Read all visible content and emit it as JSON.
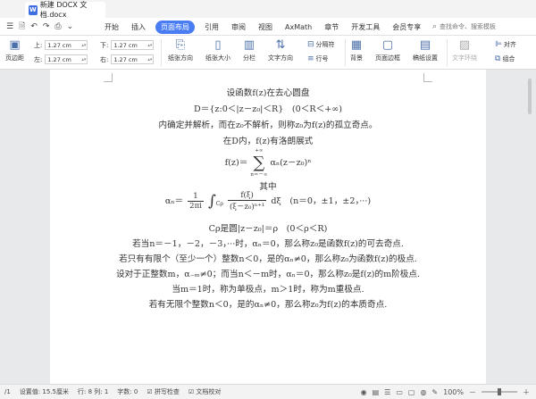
{
  "titlebar": {
    "app_icon": "W",
    "doc_title": "新建 DOCX 文档.docx"
  },
  "menubar": {
    "items": [
      "开始",
      "插入",
      "页面布局",
      "引用",
      "审阅",
      "视图",
      "AxMath",
      "章节",
      "开发工具",
      "会员专享"
    ],
    "active": "页面布局",
    "search_label": "查找命令、搜索模板"
  },
  "ribbon": {
    "margins_label": "页边距",
    "top_label": "上:",
    "top_value": "1.27 cm",
    "bottom_label": "下:",
    "bottom_value": "1.27 cm",
    "left_label": "左:",
    "left_value": "1.27 cm",
    "right_label": "右:",
    "right_value": "1.27 cm",
    "orientation": "纸张方向",
    "size": "纸张大小",
    "columns": "分栏",
    "text_direction": "文字方向",
    "separator": "分隔符",
    "line_number": "行号",
    "background": "背景",
    "page_border": "页面边框",
    "draft_settings": "稿纸设置",
    "text_wrap": "文字环绕",
    "align": "对齐",
    "group": "组合"
  },
  "document": {
    "lines": [
      "设函数f(z)在去心圆盘",
      "D＝{z:0＜|z－z₀|＜R}　(0＜R＜+∞)",
      "内确定并解析，而在z₀不解析，则称z₀为f(z)的孤立奇点。",
      "在D内，f(z)有洛朗展式",
      "其中",
      "Cρ是圆|z－z₀|＝ρ　(0＜ρ＜R)",
      "若当n＝－1，－2，－3，···时，αₙ＝0，那么称z₀是函数f(z)的可去奇点.",
      "若只有有限个（至少一个）整数n＜0，是的αₙ≠0，那么称z₀为函数f(z)的极点.",
      "设对于正整数m，α₋ₘ≠0；而当n＜－m时，αₙ＝0，那么称z₀是f(z)的m阶极点.",
      "当m＝1时，称为单极点，m＞1时，称为m重极点.",
      "若有无限个整数n＜0，是的αₙ≠0，那么称z₀为f(z)的本质奇点."
    ],
    "laurent": {
      "lhs": "f(z)＝",
      "upper": "+∞",
      "lower": "n＝－∞",
      "term": "αₙ(z－z₀)ⁿ"
    },
    "coef": {
      "lhs": "αₙ＝",
      "frac1_num": "1",
      "frac1_den": "2πi",
      "contour": "Cρ",
      "frac2_num": "f(ξ)",
      "frac2_den": "(ξ－z₀)ⁿ⁺¹",
      "tail": "dξ　(n＝0，±1，±2，···)"
    }
  },
  "statusbar": {
    "page": "/1",
    "setting_value": "设置值: 15.5厘米",
    "row_col": "行: 8  列: 1",
    "word_count": "字数: 0",
    "spell_check": "拼写检查",
    "doc_proof": "文档校对",
    "zoom": "100%"
  }
}
